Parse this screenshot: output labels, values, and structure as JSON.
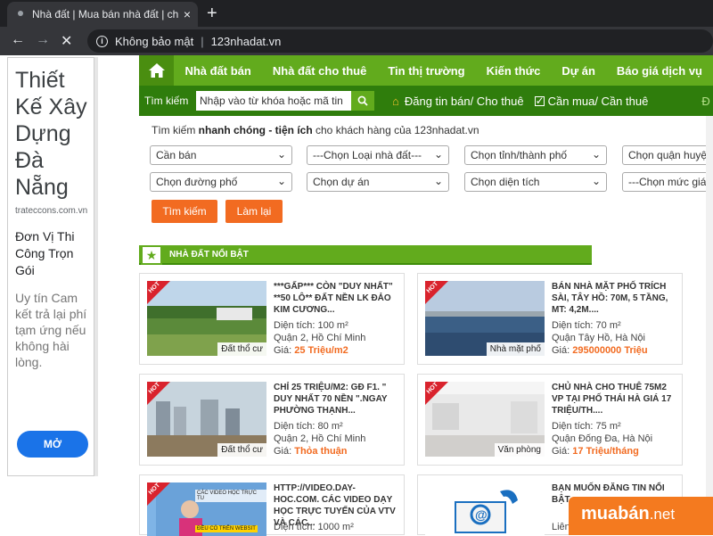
{
  "browser": {
    "tab_title": "Nhà đất | Mua bán nhà đất | cho",
    "tab_close": "×",
    "new_tab": "+",
    "security_label": "Không bảo mật",
    "url": "123nhadat.vn"
  },
  "ad": {
    "title": "Thiết Kế Xây Dựng Đà Nẵng",
    "domain": "trateccons.com.vn",
    "subtitle": "Đơn Vị Thi Công Trọn Gói",
    "description": "Uy tín Cam kết trả lại phí tạm ứng nếu không hài lòng.",
    "button": "MỞ"
  },
  "nav": {
    "items": [
      "Nhà đất bán",
      "Nhà đất cho thuê",
      "Tin thị trường",
      "Kiến thức",
      "Dự án",
      "Báo giá dịch vụ"
    ]
  },
  "subnav": {
    "search_label": "Tìm kiếm",
    "search_placeholder": "Nhập vào từ khóa hoặc mã tin",
    "post_label": "Đăng tin bán/ Cho thuê",
    "buy_label": "Cần mua/ Cần thuê",
    "trail": "Đ"
  },
  "search": {
    "tagline_prefix": "Tìm kiếm ",
    "tagline_bold": "nhanh chóng - tiện ích",
    "tagline_suffix": " cho khách hàng của 123nhadat.vn",
    "selects": [
      "Cần bán",
      "---Chọn Loại nhà đất---",
      "Chọn tỉnh/thành phố",
      "Chọn quận huyện",
      "Chọn đường phố",
      "Chọn dự án",
      "Chọn diện tích",
      "---Chọn mức giá---"
    ],
    "search_button": "Tìm kiếm",
    "reset_button": "Làm lại"
  },
  "section": {
    "title": "NHÀ ĐẤT NỔI BẬT"
  },
  "listings": [
    {
      "title": "***GẤP*** CÒN \"DUY NHẤT\" **50 LÔ** ĐẤT NỀN LK ĐẢO KIM CƯƠNG...",
      "area": "Diện tích: 100 m²",
      "location": "Quận 2, Hồ Chí Minh",
      "price_label": "Giá: ",
      "price": "25 Triệu/m2",
      "badge": "Đất thổ cư",
      "hot": "HOT"
    },
    {
      "title": "BÁN NHÀ MẶT PHỐ TRÍCH SÀI, TÂY HỒ: 70M, 5 TẦNG, MT: 4,2M....",
      "area": "Diện tích: 70 m²",
      "location": "Quận Tây Hồ, Hà Nội",
      "price_label": "Giá: ",
      "price": "295000000 Triệu",
      "badge": "Nhà mặt phố",
      "hot": "HOT"
    },
    {
      "title": "CHỈ 25 TRIỆU/M2: GĐ F1. \" DUY NHẤT 70 NỀN \".NGAY PHƯỜNG THẠNH...",
      "area": "Diện tích: 80 m²",
      "location": "Quận 2, Hồ Chí Minh",
      "price_label": "Giá: ",
      "price": "Thỏa thuận",
      "badge": "Đất thổ cư",
      "hot": "HOT"
    },
    {
      "title": "CHỦ NHÀ CHO THUÊ 75M2 VP TẠI PHỐ THÁI HÀ GIÁ 17 TRIỆU/TH....",
      "area": "Diện tích: 75 m²",
      "location": "Quận Đống Đa, Hà Nội",
      "price_label": "Giá: ",
      "price": "17 Triệu/tháng",
      "badge": "Văn phòng",
      "hot": "HOT"
    },
    {
      "title": "HTTP://VIDEO.DAY-HOC.COM. CÁC VIDEO DẠY HỌC TRỰC TUYẾN CỦA VTV VÀ CÁC...",
      "area": "Diện tích: 1000 m²",
      "location": "",
      "price_label": "",
      "price": "",
      "badge": "",
      "hot": "HOT",
      "thumb_text_1": "CÁC VIDEO HỌC TRỰC TU",
      "thumb_text_2": "ĐỀU CÓ TRÊN WEBSIT"
    },
    {
      "title": "BẠN MUỐN ĐĂNG TIN NỔI BẬT...",
      "area": "Liên",
      "location": "",
      "price_label": "",
      "price": "",
      "badge": "",
      "hot": ""
    }
  ],
  "logo": {
    "main": "muabán",
    "suffix": ".net"
  }
}
